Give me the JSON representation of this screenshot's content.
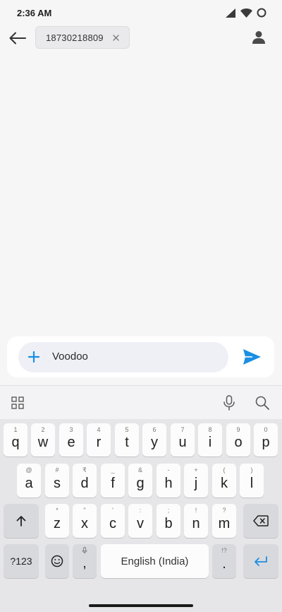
{
  "status_bar": {
    "time": "2:36 AM"
  },
  "header": {
    "recipient": "18730218809"
  },
  "compose": {
    "text": "Voodoo"
  },
  "keyboard": {
    "rows": [
      [
        {
          "hint": "1",
          "label": "q"
        },
        {
          "hint": "2",
          "label": "w"
        },
        {
          "hint": "3",
          "label": "e"
        },
        {
          "hint": "4",
          "label": "r"
        },
        {
          "hint": "5",
          "label": "t"
        },
        {
          "hint": "6",
          "label": "y"
        },
        {
          "hint": "7",
          "label": "u"
        },
        {
          "hint": "8",
          "label": "i"
        },
        {
          "hint": "9",
          "label": "o"
        },
        {
          "hint": "0",
          "label": "p"
        }
      ],
      [
        {
          "hint": "@",
          "label": "a"
        },
        {
          "hint": "#",
          "label": "s"
        },
        {
          "hint": "₹",
          "label": "d"
        },
        {
          "hint": "_",
          "label": "f"
        },
        {
          "hint": "&",
          "label": "g"
        },
        {
          "hint": "-",
          "label": "h"
        },
        {
          "hint": "+",
          "label": "j"
        },
        {
          "hint": "(",
          "label": "k"
        },
        {
          "hint": ")",
          "label": "l"
        }
      ],
      [
        {
          "hint": "*",
          "label": "z"
        },
        {
          "hint": "\"",
          "label": "x"
        },
        {
          "hint": "'",
          "label": "c"
        },
        {
          "hint": ":",
          "label": "v"
        },
        {
          "hint": ";",
          "label": "b"
        },
        {
          "hint": "!",
          "label": "n"
        },
        {
          "hint": "?",
          "label": "m"
        }
      ]
    ],
    "symbols_label": "?123",
    "comma_label": ",",
    "space_label": "English (India)",
    "period_hint": "!?",
    "period_label": "."
  },
  "colors": {
    "accent": "#1a8fe3",
    "background": "#f6f6f7",
    "keyboard_bg": "#e6e6e9"
  }
}
